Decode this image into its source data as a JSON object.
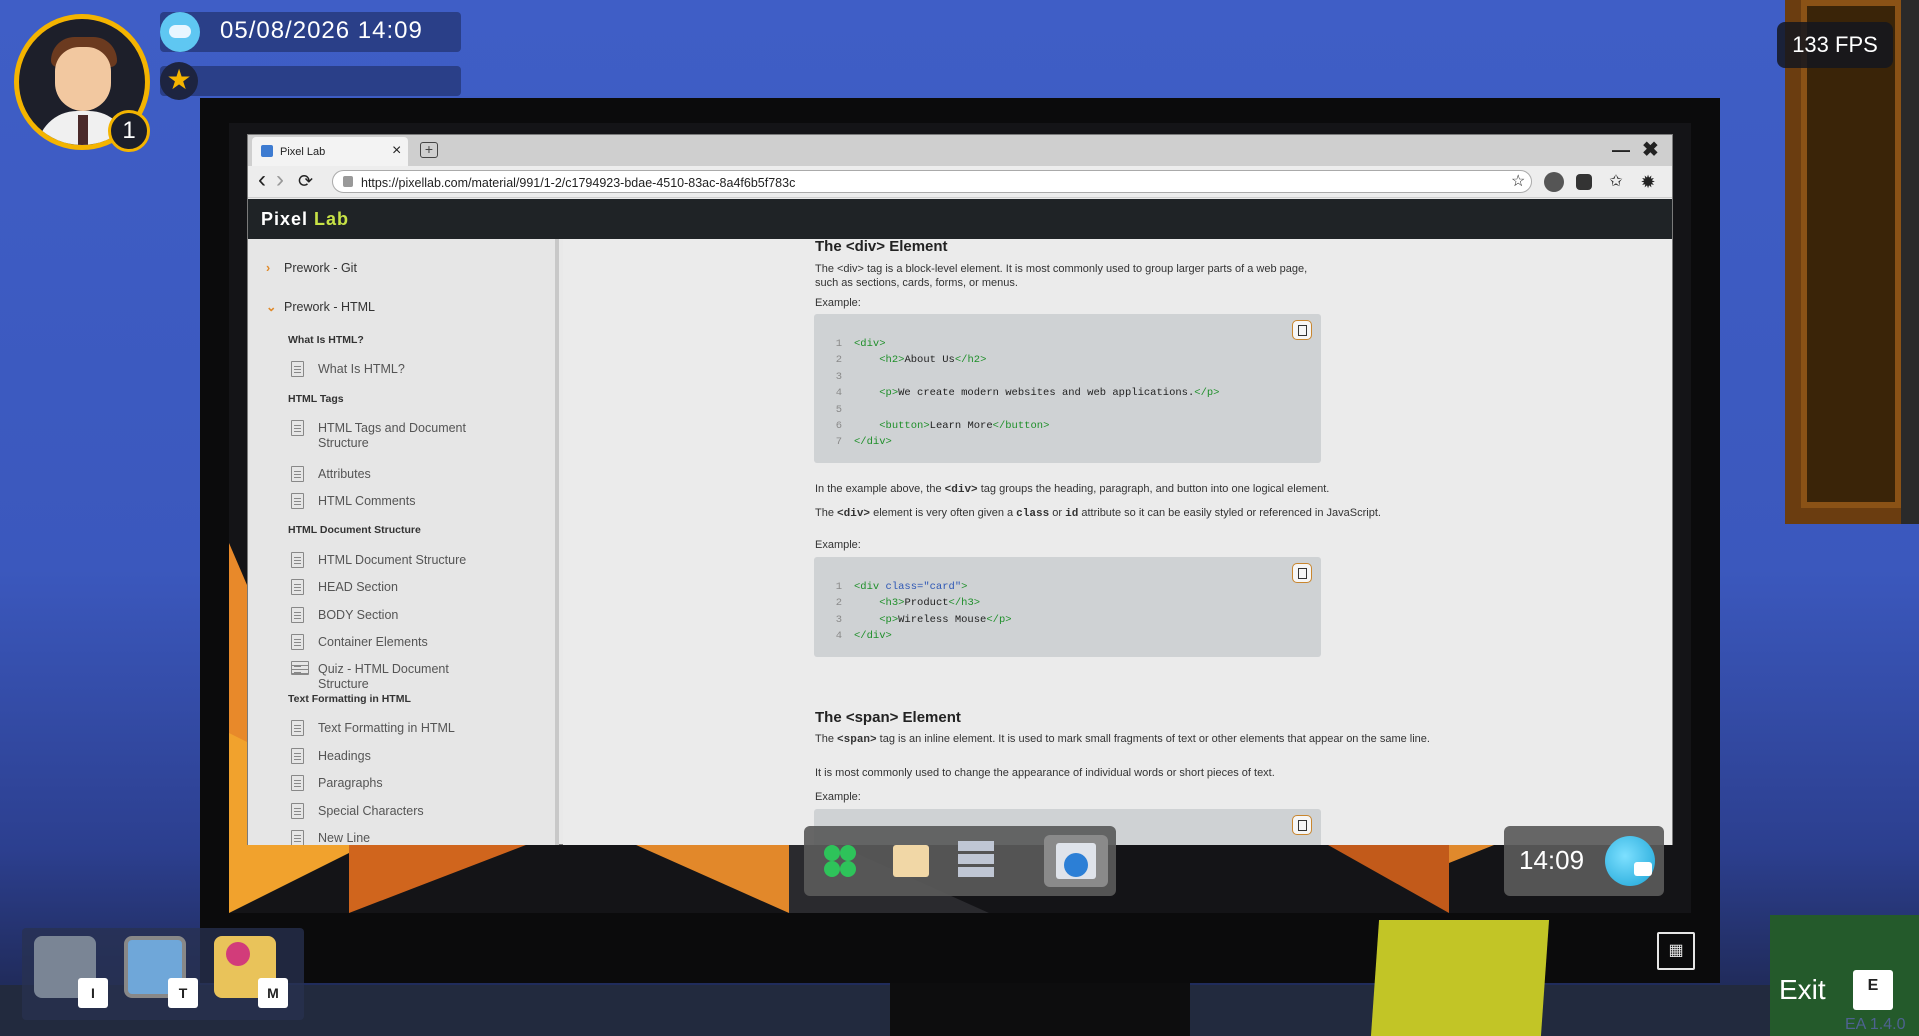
{
  "hud": {
    "level": "1",
    "datetime": "05/08/2026  14:09",
    "fps": "133 FPS",
    "version": "EA 1.4.0",
    "exit_label": "Exit",
    "exit_key": "E",
    "hotbar": [
      {
        "name": "inventory",
        "key": "I"
      },
      {
        "name": "tablet",
        "key": "T"
      },
      {
        "name": "map",
        "key": "M"
      }
    ]
  },
  "browser": {
    "tab_title": "Pixel Lab",
    "tab_close": "×",
    "new_tab": "+",
    "url": "https://pixellab.com/material/991/1-2/c1794923-bdae-4510-83ac-8a4f6b5f783c",
    "back": "‹",
    "forward": "›",
    "reload": "⟳",
    "bookmark": "☆",
    "minimize": "—",
    "close": "✖"
  },
  "app": {
    "brand_main": "Pixel ",
    "brand_accent": "Lab"
  },
  "sidebar": {
    "sections": [
      {
        "label": "Prework - Git",
        "chevron": "›"
      },
      {
        "label": "Prework - HTML",
        "chevron": "⌄"
      }
    ],
    "groups": [
      {
        "label": "What Is HTML?",
        "items": [
          "What Is HTML?"
        ]
      },
      {
        "label": "HTML Tags",
        "items": [
          "HTML Tags and Document Structure",
          "Attributes",
          "HTML Comments"
        ]
      },
      {
        "label": "HTML Document Structure",
        "items": [
          "HTML Document Structure",
          "HEAD Section",
          "BODY Section",
          "Container Elements",
          "Quiz - HTML Document Structure"
        ]
      },
      {
        "label": "Text Formatting in HTML",
        "items": [
          "Text Formatting in HTML",
          "Headings",
          "Paragraphs",
          "Special Characters",
          "New Line"
        ]
      }
    ]
  },
  "content": {
    "div_heading": "The <div> Element",
    "div_intro": "The <div> tag is a block-level element. It is most commonly used to group larger parts of a web page, such as sections, cards, forms, or menus.",
    "example_label": "Example:",
    "div_example_after_1": "tag groups the heading, paragraph, and button into one logical element.",
    "div_example_after_1_prefix": "In the example above, the ",
    "div_code_word": "<div>",
    "div_class_prefix": "The ",
    "div_class_mid1": " element is very often given a ",
    "class_word": "class",
    "or_word": " or ",
    "id_word": "id",
    "div_class_suffix": " attribute so it can be easily styled or referenced in JavaScript.",
    "span_heading": "The <span> Element",
    "span_intro_prefix": "The ",
    "span_code_word": "<span>",
    "span_intro_suffix": " tag is an inline element. It is used to mark small fragments of text or other elements that appear on the same line.",
    "span_p2": "It is most commonly used to change the appearance of individual words or short pieces of text.",
    "code1": [
      "1",
      "2",
      "3",
      "4",
      "5",
      "6",
      "7"
    ],
    "code2": [
      "1",
      "2",
      "3",
      "4"
    ]
  },
  "taskbar": {
    "clock": "14:09"
  },
  "colors": {
    "background": "#3f5ec6",
    "brand_accent": "#c7e246",
    "hud_gold": "#f4b400",
    "code_tag": "#1f8f2a",
    "code_attr": "#2f58b5"
  }
}
